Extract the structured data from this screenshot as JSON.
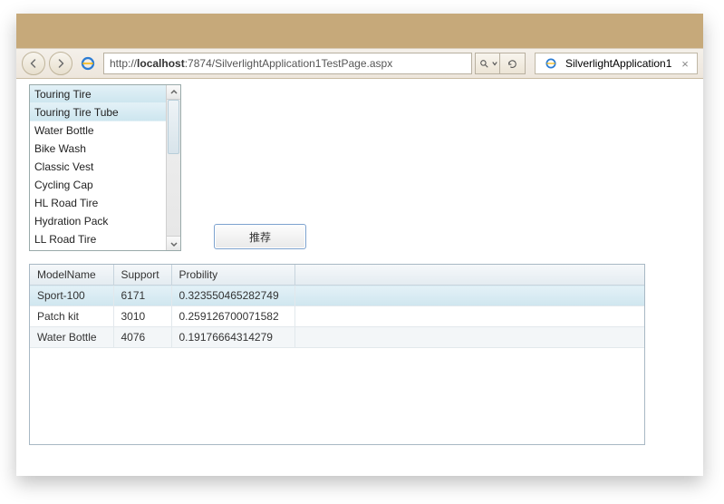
{
  "address": {
    "prefix": "http://",
    "host": "localhost",
    "rest": ":7874/SilverlightApplication1TestPage.aspx"
  },
  "tab": {
    "title": "SilverlightApplication1"
  },
  "listbox": {
    "items": [
      {
        "label": "Touring Tire",
        "selected": true
      },
      {
        "label": "Touring Tire Tube",
        "selected": true
      },
      {
        "label": "Water Bottle",
        "selected": false
      },
      {
        "label": "Bike Wash",
        "selected": false
      },
      {
        "label": "Classic Vest",
        "selected": false
      },
      {
        "label": "Cycling Cap",
        "selected": false
      },
      {
        "label": "HL Road Tire",
        "selected": false
      },
      {
        "label": "Hydration Pack",
        "selected": false
      },
      {
        "label": "LL Road Tire",
        "selected": false
      }
    ]
  },
  "button": {
    "label": "推荐"
  },
  "grid": {
    "headers": {
      "model": "ModelName",
      "support": "Support",
      "prob": "Probility"
    },
    "rows": [
      {
        "model": "Sport-100",
        "support": "6171",
        "prob": "0.323550465282749",
        "selected": true
      },
      {
        "model": "Patch kit",
        "support": "3010",
        "prob": "0.259126700071582",
        "selected": false
      },
      {
        "model": "Water Bottle",
        "support": "4076",
        "prob": "0.19176664314279",
        "selected": false
      }
    ]
  }
}
